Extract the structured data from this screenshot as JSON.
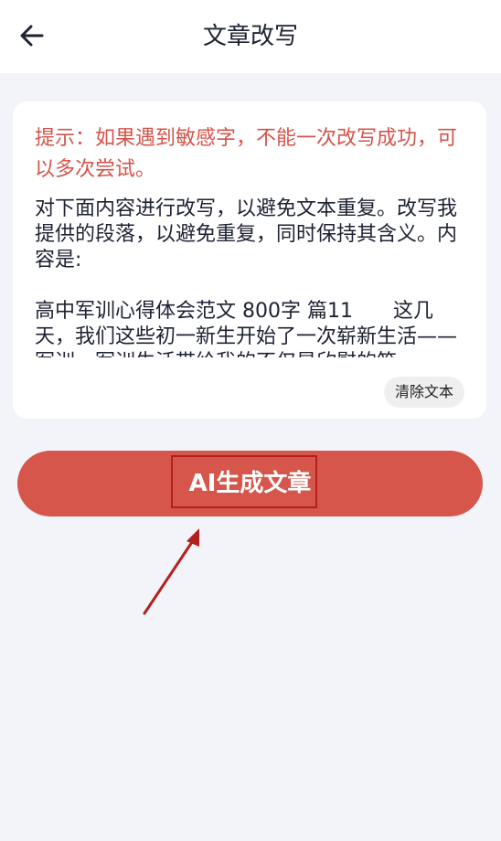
{
  "header": {
    "title": "文章改写",
    "back_icon": "arrow-left-icon"
  },
  "card": {
    "hint": "提示：如果遇到敏感字，不能一次改写成功，可以多次尝试。",
    "content": "对下面内容进行改写，以避免文本重复。改写我提供的段落，以避免重复，同时保持其含义。内容是:\n\n高中军训心得体会范文 800字 篇11　　这几天，我们这些初一新生开始了一次崭新生活——军训。军训生活带给我的不仅是欣慰的笑",
    "clear_label": "清除文本"
  },
  "action": {
    "generate_label": "AI生成文章"
  },
  "colors": {
    "accent": "#d6564b",
    "hint_text": "#d4544a",
    "annotation": "#b3201d",
    "background": "#f3f4f9"
  }
}
